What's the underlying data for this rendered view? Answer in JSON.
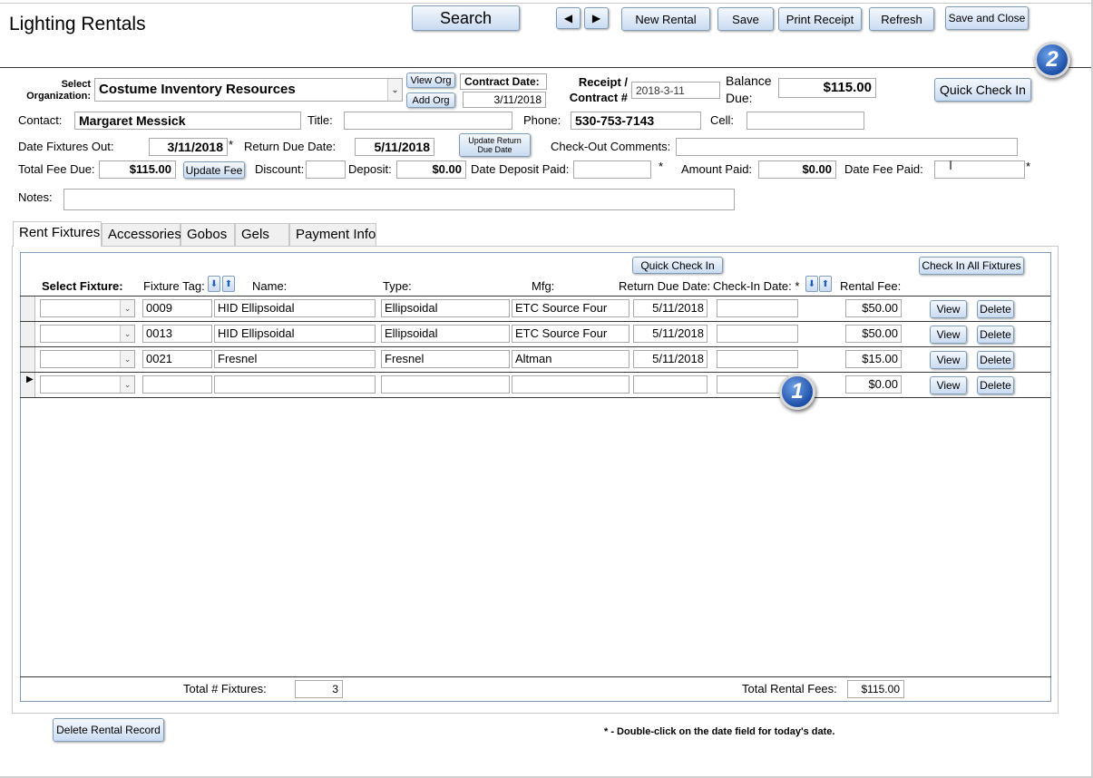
{
  "title": "Lighting Rentals",
  "toolbar": {
    "search": "Search",
    "prev_icon": "triangle-left-icon",
    "next_icon": "triangle-right-icon",
    "new_rental": "New Rental",
    "save": "Save",
    "print_receipt": "Print Receipt",
    "refresh": "Refresh",
    "save_close": "Save and Close"
  },
  "header": {
    "select_org_label": "Select Organization:",
    "organization": "Costume Inventory Resources",
    "view_org": "View Org",
    "add_org": "Add Org",
    "contract_date_label": "Contract Date:",
    "contract_date": "3/11/2018",
    "receipt_label": "Receipt / Contract #",
    "receipt_value": "2018-3-11",
    "balance_label": "Balance Due:",
    "balance_value": "$115.00",
    "quick_check_in": "Quick Check In",
    "contact_label": "Contact:",
    "contact": "Margaret Messick",
    "title_label": "Title:",
    "title_value": "",
    "phone_label": "Phone:",
    "phone": "530-753-7143",
    "cell_label": "Cell:",
    "cell_value": "",
    "date_out_label": "Date Fixtures Out:",
    "date_out": "3/11/2018",
    "star": "*",
    "return_due_label": "Return Due Date:",
    "return_due": "5/11/2018",
    "update_return": "Update Return Due Date",
    "checkout_comments_label": "Check-Out Comments:",
    "checkout_comments": "",
    "total_fee_label": "Total Fee Due:",
    "total_fee": "$115.00",
    "update_fee": "Update Fee",
    "discount_label": "Discount:",
    "discount": "",
    "deposit_label": "Deposit:",
    "deposit": "$0.00",
    "date_deposit_label": "Date Deposit Paid:",
    "date_deposit": "",
    "amount_paid_label": "Amount Paid:",
    "amount_paid": "$0.00",
    "date_fee_paid_label": "Date Fee Paid:",
    "date_fee_paid": "",
    "notes_label": "Notes:",
    "notes": ""
  },
  "tabs": [
    "Rent Fixtures",
    "Accessories",
    "Gobos",
    "Gels",
    "Payment Info"
  ],
  "grid": {
    "quick_check_in": "Quick Check In",
    "check_in_all": "Check In All Fixtures",
    "columns": {
      "select_fixture": "Select Fixture:",
      "fixture_tag": "Fixture Tag:",
      "name": "Name:",
      "type": "Type:",
      "mfg": "Mfg:",
      "return_due": "Return Due Date:",
      "check_in": "Check-In Date: *",
      "rental_fee": "Rental Fee:"
    },
    "view": "View",
    "delete": "Delete",
    "rows": [
      {
        "tag": "0009",
        "name": "HID Ellipsoidal",
        "type": "Ellipsoidal",
        "mfg": "ETC Source Four",
        "return_due": "5/11/2018",
        "check_in": "",
        "fee": "$50.00"
      },
      {
        "tag": "0013",
        "name": "HID Ellipsoidal",
        "type": "Ellipsoidal",
        "mfg": "ETC Source Four",
        "return_due": "5/11/2018",
        "check_in": "",
        "fee": "$50.00"
      },
      {
        "tag": "0021",
        "name": "Fresnel",
        "type": "Fresnel",
        "mfg": "Altman",
        "return_due": "5/11/2018",
        "check_in": "",
        "fee": "$15.00"
      },
      {
        "tag": "",
        "name": "",
        "type": "",
        "mfg": "",
        "return_due": "",
        "check_in": "",
        "fee": "$0.00"
      }
    ],
    "total_fixtures_label": "Total # Fixtures:",
    "total_fixtures": "3",
    "total_fees_label": "Total Rental Fees:",
    "total_fees": "$115.00"
  },
  "footer": {
    "delete_record": "Delete Rental Record",
    "note": "* - Double-click on the date field for today's date."
  },
  "badges": {
    "one": "1",
    "two": "2"
  }
}
